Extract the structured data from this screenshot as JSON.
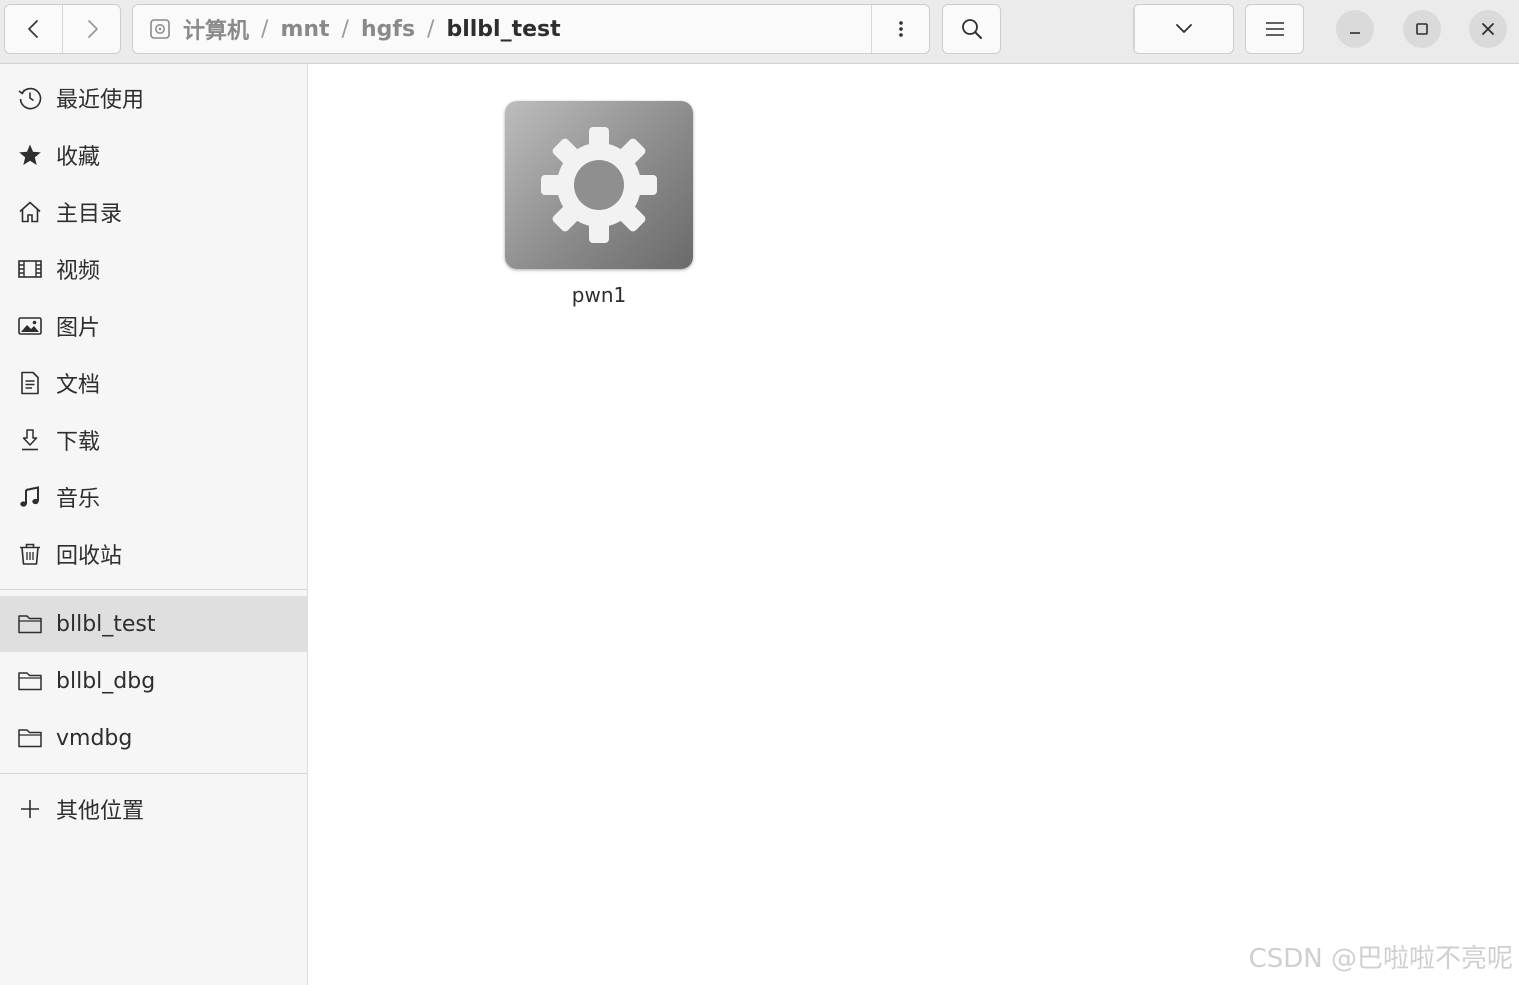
{
  "header": {
    "back_icon": "chevron-left-icon",
    "forward_icon": "chevron-right-icon",
    "path": {
      "root_icon": "drive-icon",
      "crumbs": [
        "计算机",
        "mnt",
        "hgfs",
        "bllbl_test"
      ],
      "separator": "/"
    },
    "path_menu_icon": "vertical-dots-icon",
    "search_icon": "search-icon",
    "view_list_icon": "list-view-icon",
    "view_dropdown_icon": "chevron-down-icon",
    "menu_icon": "hamburger-icon",
    "window_controls": [
      "minimize-icon",
      "maximize-icon",
      "close-icon"
    ]
  },
  "sidebar": {
    "places": [
      {
        "label": "最近使用",
        "icon": "clock-icon"
      },
      {
        "label": "收藏",
        "icon": "star-icon"
      },
      {
        "label": "主目录",
        "icon": "home-icon"
      },
      {
        "label": "视频",
        "icon": "film-icon"
      },
      {
        "label": "图片",
        "icon": "picture-icon"
      },
      {
        "label": "文档",
        "icon": "document-icon"
      },
      {
        "label": "下载",
        "icon": "download-icon"
      },
      {
        "label": "音乐",
        "icon": "music-icon"
      },
      {
        "label": "回收站",
        "icon": "trash-icon"
      }
    ],
    "bookmarks": [
      {
        "label": "bllbl_test",
        "icon": "folder-icon",
        "selected": true
      },
      {
        "label": "bllbl_dbg",
        "icon": "folder-icon",
        "selected": false
      },
      {
        "label": "vmdbg",
        "icon": "folder-icon",
        "selected": false
      }
    ],
    "other_locations": {
      "label": "其他位置",
      "icon": "plus-icon"
    }
  },
  "main": {
    "files": [
      {
        "name": "pwn1",
        "icon": "executable-gear-icon"
      }
    ]
  },
  "watermark": "CSDN @巴啦啦不亮呢",
  "colors": {
    "header_bg": "#ebebeb",
    "sidebar_bg": "#f6f6f6",
    "selected_bg": "#dfdfdf",
    "text": "#2e2e2e"
  }
}
